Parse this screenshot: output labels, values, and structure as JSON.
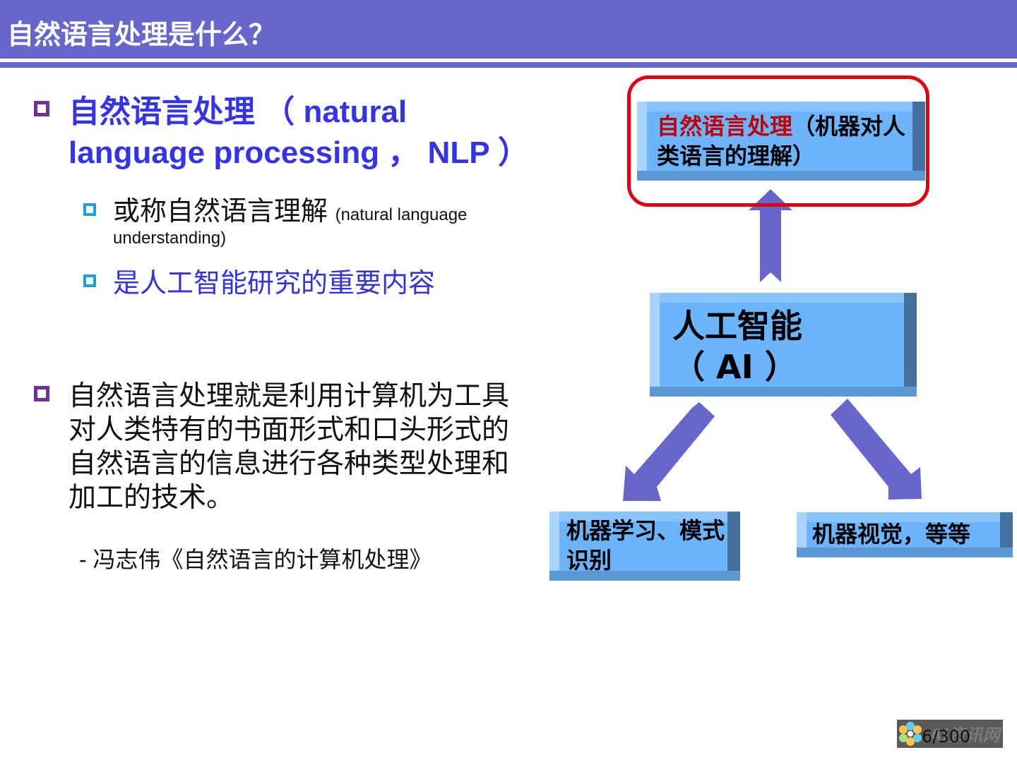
{
  "slide": {
    "title": "自然语言处理是什么？",
    "page_indicator": "6/300",
    "watermark": "AI资讯网"
  },
  "left": {
    "heading": "自然语言处理 （ natural language processing ， NLP ）",
    "sub_items": [
      {
        "text_cn": "或称自然语言理解",
        "text_en": "(natural language understanding)",
        "text_en_line1": "(natural language",
        "text_en_line2": "understanding)"
      },
      {
        "text": "是人工智能研究的重要内容"
      }
    ],
    "definition": "自然语言处理就是利用计算机为工具对人类特有的书面形式和口头形式的自然语言的信息进行各种类型处理和加工的技术。",
    "citation": "- 冯志伟《自然语言的计算机处理》"
  },
  "diagram": {
    "nlp_box": {
      "highlight": "自然语言处理",
      "rest": "（机器对人类语言的理解）"
    },
    "ai_box": {
      "line1": "人工智能",
      "line2": "（ AI ）"
    },
    "ml_box": {
      "text": "机器学习、模式识别"
    },
    "cv_box": {
      "text": "机器视觉，等等"
    },
    "colors": {
      "arrow": "#6666cc",
      "box_face": "#6cb4fb",
      "highlight_ring": "#e00010",
      "highlight_text": "#c00000"
    }
  }
}
